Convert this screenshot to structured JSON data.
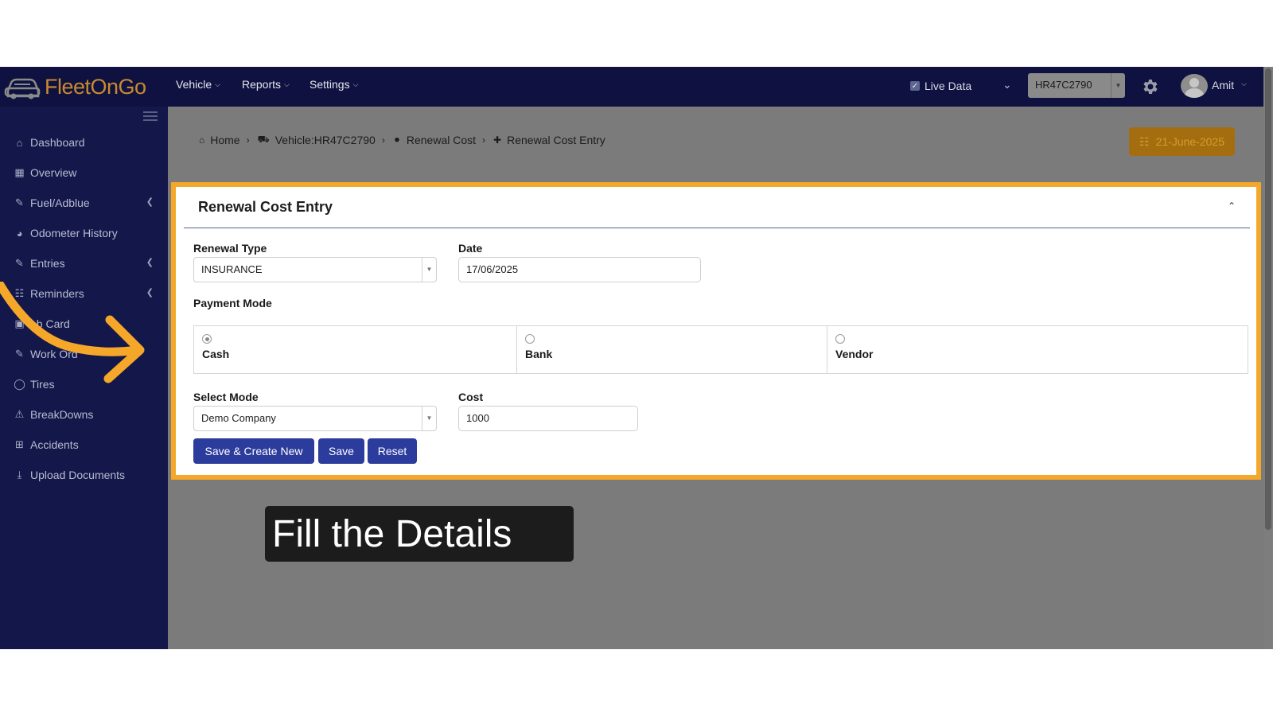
{
  "app": {
    "logo_text": "FleetOnGo"
  },
  "topnav": {
    "menus": [
      "Vehicle",
      "Reports",
      "Settings"
    ],
    "live_data_label": "Live Data",
    "vehicle_select": "HR47C2790",
    "user_name": "Amit"
  },
  "sidebar": {
    "items": [
      {
        "label": "Dashboard",
        "icon": "home-icon"
      },
      {
        "label": "Overview",
        "icon": "grid-icon"
      },
      {
        "label": "Fuel/Adblue",
        "icon": "edit-icon",
        "expandable": true
      },
      {
        "label": "Odometer History",
        "icon": "gauge-icon"
      },
      {
        "label": "Entries",
        "icon": "edit-icon",
        "expandable": true
      },
      {
        "label": "Reminders",
        "icon": "calendar-icon",
        "expandable": true
      },
      {
        "label": "Job Card",
        "icon": "card-icon",
        "visible_text": "ob Card"
      },
      {
        "label": "Work Order",
        "icon": "edit-icon",
        "visible_text": "Work Ord"
      },
      {
        "label": "Tires",
        "icon": "circle-icon"
      },
      {
        "label": "BreakDowns",
        "icon": "warning-icon"
      },
      {
        "label": "Accidents",
        "icon": "plus-square-icon"
      },
      {
        "label": "Upload Documents",
        "icon": "download-icon"
      }
    ]
  },
  "breadcrumb": {
    "items": [
      "Home",
      "Vehicle:HR47C2790",
      "Renewal Cost",
      "Renewal Cost Entry"
    ]
  },
  "date_badge": "21-June-2025",
  "form": {
    "title": "Renewal Cost Entry",
    "renewal_type_label": "Renewal Type",
    "renewal_type_value": "INSURANCE",
    "date_label": "Date",
    "date_value": "17/06/2025",
    "payment_mode_label": "Payment Mode",
    "payment_options": [
      {
        "label": "Cash",
        "selected": true
      },
      {
        "label": "Bank",
        "selected": false
      },
      {
        "label": "Vendor",
        "selected": false
      }
    ],
    "select_mode_label": "Select Mode",
    "select_mode_value": "Demo Company",
    "cost_label": "Cost",
    "cost_value": "1000",
    "buttons": {
      "save_create_new": "Save & Create New",
      "save": "Save",
      "reset": "Reset"
    }
  },
  "caption": "Fill the Details",
  "colors": {
    "topbar": "#0f1240",
    "sidebar": "#13174a",
    "accent_highlight": "#f5a72a",
    "button": "#2c3c9c",
    "date_badge": "#a46e10"
  }
}
